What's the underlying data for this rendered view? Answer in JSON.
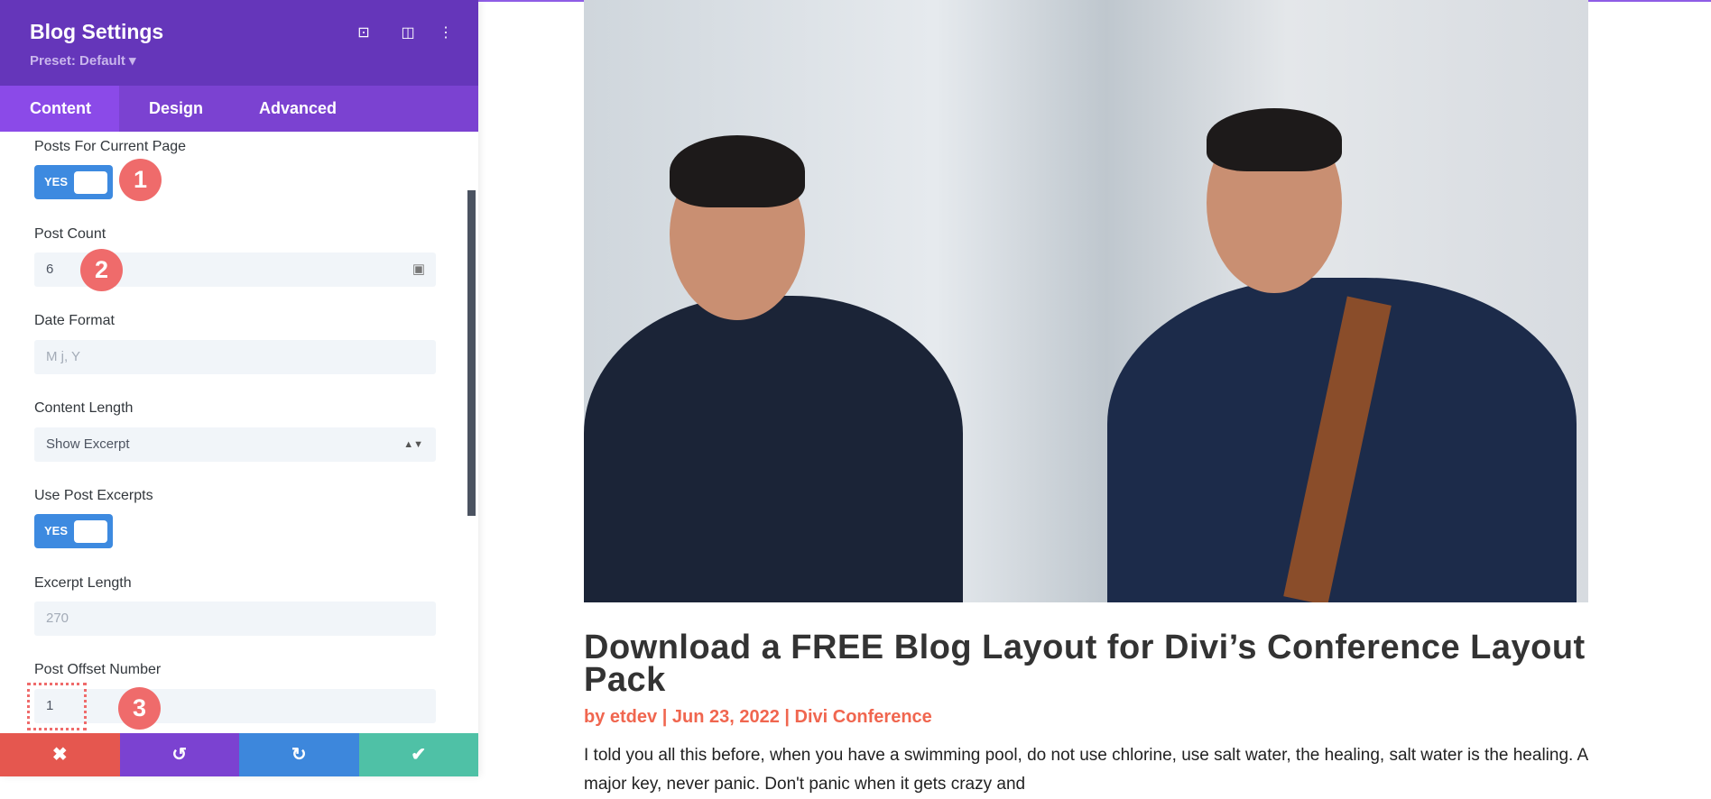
{
  "panel": {
    "title": "Blog Settings",
    "preset": "Preset: Default ▾",
    "icons": [
      "focus-icon",
      "split-view-icon",
      "more-options-icon"
    ],
    "tabs": [
      {
        "label": "Content",
        "active": true
      },
      {
        "label": "Design"
      },
      {
        "label": "Advanced"
      }
    ],
    "fields": {
      "posts_current_page": {
        "label": "Posts For Current Page",
        "value": "YES"
      },
      "post_count": {
        "label": "Post Count",
        "value": "6"
      },
      "date_format": {
        "label": "Date Format",
        "placeholder": "M j, Y"
      },
      "content_length": {
        "label": "Content Length",
        "value": "Show Excerpt"
      },
      "use_post_excerpts": {
        "label": "Use Post Excerpts",
        "value": "YES"
      },
      "excerpt_length": {
        "label": "Excerpt Length",
        "placeholder": "270"
      },
      "post_offset": {
        "label": "Post Offset Number",
        "value": "1"
      }
    },
    "badges": [
      "1",
      "2",
      "3"
    ],
    "footer": {
      "cancel": "✖",
      "undo": "↺",
      "redo": "↻",
      "save": "✔"
    },
    "colors": {
      "header": "#6536ba",
      "tabs": "#7b42d1",
      "toggle": "#3d8ae0",
      "badge": "#ef6b6b",
      "cancel": "#e5574f",
      "undo": "#7b42d1",
      "redo": "#3d87dc",
      "save": "#4fc1a6"
    }
  },
  "post": {
    "title": "Download a FREE Blog Layout for Divi’s Conference Layout Pack",
    "meta": "by etdev | Jun 23, 2022 | Divi Conference",
    "excerpt": "I told you all this before, when you have a swimming pool, do not use chlorine, use salt water, the healing, salt water is the healing. A major key, never panic. Don't panic when it gets crazy and"
  }
}
